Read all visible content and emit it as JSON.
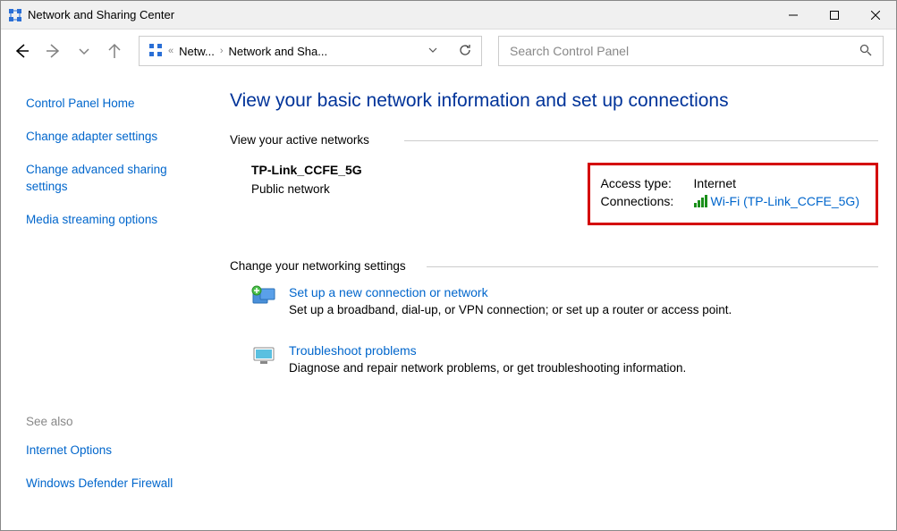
{
  "window": {
    "title": "Network and Sharing Center"
  },
  "breadcrumb": {
    "item1": "Netw...",
    "item2": "Network and Sha..."
  },
  "search": {
    "placeholder": "Search Control Panel"
  },
  "sidebar": {
    "home": "Control Panel Home",
    "adapter": "Change adapter settings",
    "adv": "Change advanced sharing settings",
    "media": "Media streaming options"
  },
  "seealso": {
    "label": "See also",
    "internet": "Internet Options",
    "firewall": "Windows Defender Firewall"
  },
  "main": {
    "title": "View your basic network information and set up connections",
    "active_header": "View your active networks",
    "network_name": "TP-Link_CCFE_5G",
    "network_type": "Public network",
    "access_label": "Access type:",
    "access_value": "Internet",
    "conn_label": "Connections:",
    "conn_value": "Wi-Fi (TP-Link_CCFE_5G)",
    "change_header": "Change your networking settings",
    "setup_title": "Set up a new connection or network",
    "setup_desc": "Set up a broadband, dial-up, or VPN connection; or set up a router or access point.",
    "trouble_title": "Troubleshoot problems",
    "trouble_desc": "Diagnose and repair network problems, or get troubleshooting information."
  }
}
